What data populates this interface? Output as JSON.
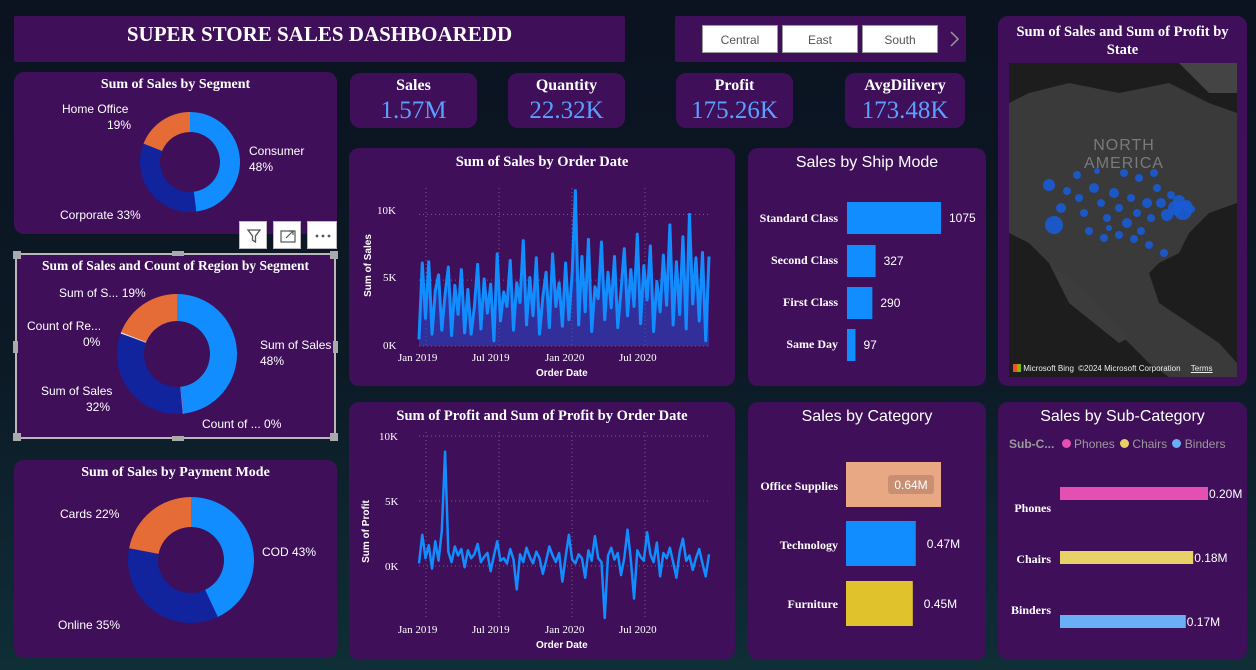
{
  "header": {
    "title": "SUPER STORE SALES DASHBOAREDD"
  },
  "slicer": {
    "items": [
      "Central",
      "East",
      "South"
    ],
    "next_icon": "chevron-right-icon"
  },
  "kpis": [
    {
      "label": "Sales",
      "value": "1.57M"
    },
    {
      "label": "Quantity",
      "value": "22.32K"
    },
    {
      "label": "Profit",
      "value": "175.26K"
    },
    {
      "label": "AvgDilivery",
      "value": "173.48K"
    }
  ],
  "visual_toolbar": {
    "icons": [
      "filter-icon",
      "focus-mode-icon",
      "more-options-icon"
    ]
  },
  "map": {
    "title": "Sum of Sales and Sum of Profit by State",
    "region_label": "NORTH AMERICA",
    "logo": "Microsoft Bing",
    "copyright": "©2024 Microsoft Corporation",
    "terms": "Terms"
  },
  "colors": {
    "card": "#3f0f5a",
    "blue": "#118dff",
    "navy": "#12239e",
    "orange": "#e66c37",
    "peach": "#e8a884",
    "yellow": "#e0c22c",
    "pink": "#e44fb2",
    "sand": "#e8d166",
    "light_blue": "#6aaff6"
  },
  "chart_data": [
    {
      "id": "segment",
      "type": "pie",
      "title": "Sum of Sales by Segment",
      "slices": [
        {
          "name": "Consumer",
          "value": 48,
          "label": "Consumer",
          "pct": "48%",
          "color": "#118dff"
        },
        {
          "name": "Corporate",
          "value": 33,
          "label": "Corporate 33%",
          "color": "#12239e"
        },
        {
          "name": "Home Office",
          "value": 19,
          "label": "Home Office",
          "pct": "19%",
          "color": "#e66c37"
        }
      ]
    },
    {
      "id": "region_segment",
      "type": "pie",
      "title": "Sum of Sales and Count of Region by Segment",
      "slices": [
        {
          "value": 48,
          "label": "Sum of Sales",
          "pct": "48%",
          "color": "#118dff"
        },
        {
          "value": 0.4,
          "label": "Count of ... 0%",
          "color": "#6b7fd6"
        },
        {
          "value": 32,
          "label": "Sum of Sales",
          "pct": "32%",
          "color": "#12239e"
        },
        {
          "value": 0.4,
          "label": "Count of Re...",
          "pct": "0%",
          "color": "#e0e0e0"
        },
        {
          "value": 19,
          "label": "Sum of S... 19%",
          "color": "#e66c37"
        }
      ]
    },
    {
      "id": "payment",
      "type": "pie",
      "title": "Sum of Sales by Payment Mode",
      "slices": [
        {
          "name": "COD",
          "value": 43,
          "label": "COD 43%",
          "color": "#118dff"
        },
        {
          "name": "Online",
          "value": 35,
          "label": "Online 35%",
          "color": "#12239e"
        },
        {
          "name": "Cards",
          "value": 22,
          "label": "Cards 22%",
          "color": "#e66c37"
        }
      ]
    },
    {
      "id": "sales_date",
      "type": "area",
      "title": "Sum of Sales by Order Date",
      "xlabel": "Order Date",
      "ylabel": "Sum of Sales",
      "ylim": [
        0,
        12000
      ],
      "xticks": [
        "Jan 2019",
        "Jul 2019",
        "Jan 2020",
        "Jul 2020"
      ],
      "yticks": [
        "0K",
        "5K",
        "10K"
      ],
      "values": [
        500,
        6300,
        2100,
        6400,
        900,
        4200,
        5400,
        1200,
        3900,
        6000,
        800,
        4600,
        2400,
        5800,
        1000,
        4300,
        900,
        3000,
        6200,
        1300,
        5100,
        2500,
        4700,
        400,
        7000,
        1900,
        4100,
        3000,
        6500,
        1200,
        4800,
        3300,
        8000,
        1600,
        5200,
        2300,
        6700,
        900,
        3700,
        5600,
        1400,
        7000,
        3000,
        4800,
        1500,
        6300,
        2000,
        5500,
        11800,
        1600,
        6800,
        2600,
        8100,
        1100,
        4500,
        3600,
        7900,
        2000,
        5600,
        2900,
        6800,
        1400,
        4200,
        7400,
        2300,
        5800,
        3000,
        8500,
        1700,
        6100,
        3500,
        7600,
        1100,
        4900,
        2600,
        6900,
        3100,
        9200,
        1600,
        6400,
        2400,
        8300,
        1300,
        10000,
        3200,
        6700,
        1900,
        7100,
        400,
        6800
      ]
    },
    {
      "id": "profit_date",
      "type": "line",
      "title": "Sum of Profit and Sum of Profit by Order Date",
      "xlabel": "Order Date",
      "ylabel": "Sum of Profit",
      "ylim": [
        -4500,
        10000
      ],
      "xticks": [
        "Jan 2019",
        "Jul 2019",
        "Jan 2020",
        "Jul 2020"
      ],
      "yticks": [
        "0K",
        "5K",
        "10K"
      ],
      "values": [
        200,
        2400,
        600,
        1600,
        -200,
        1900,
        400,
        2700,
        8800,
        1100,
        300,
        1500,
        800,
        1300,
        -100,
        1200,
        600,
        900,
        1700,
        300,
        700,
        1000,
        -400,
        800,
        1900,
        400,
        600,
        200,
        1300,
        500,
        -1800,
        900,
        300,
        1400,
        700,
        200,
        1100,
        600,
        -600,
        400,
        1500,
        800,
        300,
        1000,
        -1200,
        700,
        2400,
        500,
        200,
        900,
        600,
        -900,
        1200,
        400,
        2300,
        600,
        300,
        -4000,
        800,
        1400,
        500,
        1000,
        -700,
        600,
        2800,
        500,
        -2500,
        1200,
        700,
        400,
        2600,
        900,
        300,
        1800,
        -800,
        1000,
        600,
        1400,
        300,
        -900,
        1100,
        2100,
        400,
        800,
        -300,
        600,
        1300,
        200,
        -800,
        900
      ]
    },
    {
      "id": "ship_mode",
      "type": "bar",
      "title": "Sales by Ship Mode",
      "categories": [
        "Standard Class",
        "Second Class",
        "First Class",
        "Same Day"
      ],
      "values": [
        1075,
        327,
        290,
        97
      ],
      "labels": [
        "1075",
        "327",
        "290",
        "97"
      ],
      "xlim": [
        0,
        1075
      ]
    },
    {
      "id": "category",
      "type": "bar",
      "title": "Sales by Category",
      "categories": [
        "Office Supplies",
        "Technology",
        "Furniture"
      ],
      "values": [
        0.64,
        0.47,
        0.45
      ],
      "labels": [
        "0.64M",
        "0.47M",
        "0.45M"
      ],
      "colors": [
        "#e8a884",
        "#118dff",
        "#e0c22c"
      ],
      "xlim": [
        0,
        0.64
      ]
    },
    {
      "id": "sub_category",
      "type": "bar",
      "title": "Sales by Sub-Category",
      "legend_title": "Sub-C...",
      "categories": [
        "Phones",
        "Chairs",
        "Binders"
      ],
      "values": [
        0.2,
        0.18,
        0.17
      ],
      "labels": [
        "0.20M",
        "0.18M",
        "0.17M"
      ],
      "colors": [
        "#e44fb2",
        "#e8d166",
        "#6aaff6"
      ],
      "xlim": [
        0,
        0.2
      ]
    }
  ]
}
